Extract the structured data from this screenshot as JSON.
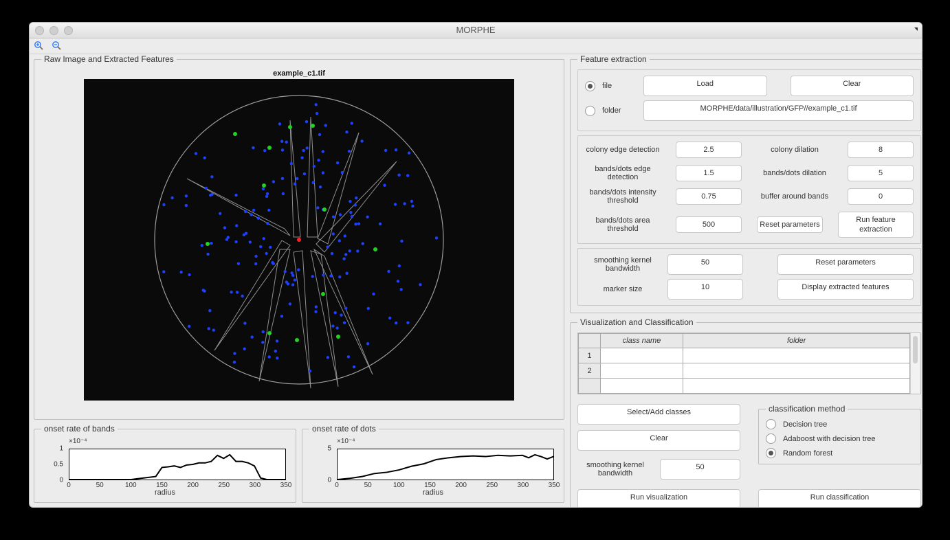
{
  "window": {
    "title": "MORPHE"
  },
  "left": {
    "panel_title": "Raw Image and Extracted Features",
    "image_title": "example_c1.tif",
    "bands_plot": {
      "panel_title": "onset rate of bands",
      "ytitle": "×10⁻⁴",
      "xlabel": "radius",
      "xlim": [
        0,
        350
      ],
      "ylim": [
        0,
        1
      ],
      "xticks": [
        0,
        50,
        100,
        150,
        200,
        250,
        300,
        350
      ],
      "yticks": [
        0,
        0.5,
        1
      ]
    },
    "dots_plot": {
      "panel_title": "onset rate of dots",
      "ytitle": "×10⁻⁴",
      "xlabel": "radius",
      "xlim": [
        0,
        350
      ],
      "ylim": [
        0,
        5
      ],
      "xticks": [
        0,
        50,
        100,
        150,
        200,
        250,
        300,
        350
      ],
      "yticks": [
        0,
        5
      ]
    }
  },
  "fe": {
    "panel_title": "Feature extraction",
    "file_label": "file",
    "folder_label": "folder",
    "load_btn": "Load",
    "clear_btn": "Clear",
    "path": "MORPHE/data/illustration/GFP//example_c1.tif",
    "params": {
      "colony_edge_label": "colony edge detection",
      "colony_edge_value": "2.5",
      "colony_dilation_label": "colony dilation",
      "colony_dilation_value": "8",
      "bd_edge_label": "bands/dots edge detection",
      "bd_edge_value": "1.5",
      "bd_dilation_label": "bands/dots dilation",
      "bd_dilation_value": "5",
      "bd_intensity_label": "bands/dots intensity threshold",
      "bd_intensity_value": "0.75",
      "buffer_label": "buffer around bands",
      "buffer_value": "0",
      "bd_area_label": "bands/dots area threshold",
      "bd_area_value": "500",
      "reset_btn": "Reset parameters",
      "run_btn": "Run feature extraction"
    },
    "display": {
      "smooth_label": "smoothing kernel bandwidth",
      "smooth_value": "50",
      "marker_label": "marker size",
      "marker_value": "10",
      "reset_btn": "Reset parameters",
      "display_btn": "Display extracted features"
    }
  },
  "vc": {
    "panel_title": "Visualization and Classification",
    "table": {
      "col1": "class name",
      "col2": "folder",
      "rows": [
        "1",
        "2",
        ""
      ]
    },
    "select_btn": "Select/Add classes",
    "clear_btn": "Clear",
    "smooth_label": "smoothing kernel bandwidth",
    "smooth_value": "50",
    "run_vis_btn": "Run visualization",
    "run_cls_btn": "Run classification",
    "method": {
      "legend": "classification method",
      "dt": "Decision tree",
      "ada": "Adaboost with decision tree",
      "rf": "Random forest"
    }
  },
  "chart_data": [
    {
      "name": "onset rate of bands",
      "type": "line",
      "xlabel": "radius",
      "ylabel": "",
      "y_scale_note": "×10⁻⁴",
      "xlim": [
        0,
        360
      ],
      "ylim": [
        0,
        1
      ],
      "x": [
        0,
        20,
        40,
        60,
        80,
        100,
        120,
        140,
        150,
        160,
        170,
        180,
        190,
        200,
        210,
        220,
        230,
        240,
        250,
        260,
        270,
        280,
        290,
        300,
        310,
        320,
        340,
        360
      ],
      "y": [
        0,
        0,
        0,
        0,
        0,
        0,
        0.05,
        0.1,
        0.4,
        0.42,
        0.45,
        0.4,
        0.48,
        0.5,
        0.55,
        0.55,
        0.6,
        0.8,
        0.7,
        0.82,
        0.6,
        0.6,
        0.55,
        0.45,
        0.05,
        0,
        0,
        0
      ]
    },
    {
      "name": "onset rate of dots",
      "type": "line",
      "xlabel": "radius",
      "ylabel": "",
      "y_scale_note": "×10⁻⁴",
      "xlim": [
        0,
        360
      ],
      "ylim": [
        0,
        5
      ],
      "x": [
        0,
        20,
        40,
        60,
        80,
        100,
        120,
        140,
        160,
        180,
        200,
        220,
        240,
        260,
        280,
        300,
        310,
        320,
        330,
        340,
        350,
        360
      ],
      "y": [
        0,
        0.2,
        0.5,
        1.0,
        1.2,
        1.6,
        2.2,
        2.6,
        3.3,
        3.6,
        3.8,
        3.9,
        3.8,
        4.0,
        3.9,
        4.0,
        3.6,
        4.1,
        3.8,
        3.4,
        3.8,
        3.2
      ]
    }
  ]
}
